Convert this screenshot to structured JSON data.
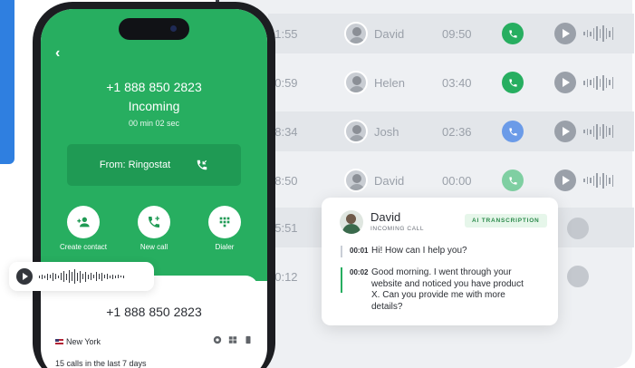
{
  "call_list": {
    "rows": [
      {
        "time": "51:55",
        "name": "David",
        "duration": "09:50",
        "button_color": "#27ae60"
      },
      {
        "time": "50:59",
        "name": "Helen",
        "duration": "03:40",
        "button_color": "#27ae60"
      },
      {
        "time": "48:34",
        "name": "Josh",
        "duration": "02:36",
        "button_color": "#2f7fe0"
      },
      {
        "time": "38:50",
        "name": "David",
        "duration": "00:00",
        "button_color": "#27ae60"
      },
      {
        "time": "25:51",
        "name": "",
        "duration": "",
        "button_color": ""
      },
      {
        "time": "20:12",
        "name": "",
        "duration": "",
        "button_color": ""
      }
    ]
  },
  "phone": {
    "number": "+1 888 850 2823",
    "status": "Incoming",
    "timer": "00 min 02 sec",
    "from_label": "From: Ringostat",
    "actions": [
      {
        "label": "Create contact",
        "icon": "add-person-icon"
      },
      {
        "label": "New call",
        "icon": "add-call-icon"
      },
      {
        "label": "Dialer",
        "icon": "dialpad-icon"
      }
    ],
    "contact_number": "+1 888 850 2823",
    "city": "New York",
    "calls_summary": "15 calls in the last 7 days"
  },
  "transcription": {
    "name": "David",
    "subtitle": "INCOMING CALL",
    "badge": "AI TRANSCRIPTION",
    "lines": [
      {
        "time": "00:01",
        "text": "Hi! How can I help you?"
      },
      {
        "time": "00:02",
        "text": "Good morning. I went through your website and noticed you have product X. Can you provide me with more details?"
      }
    ]
  },
  "colors": {
    "accent_green": "#27ae60",
    "accent_blue": "#2f7fe0"
  }
}
